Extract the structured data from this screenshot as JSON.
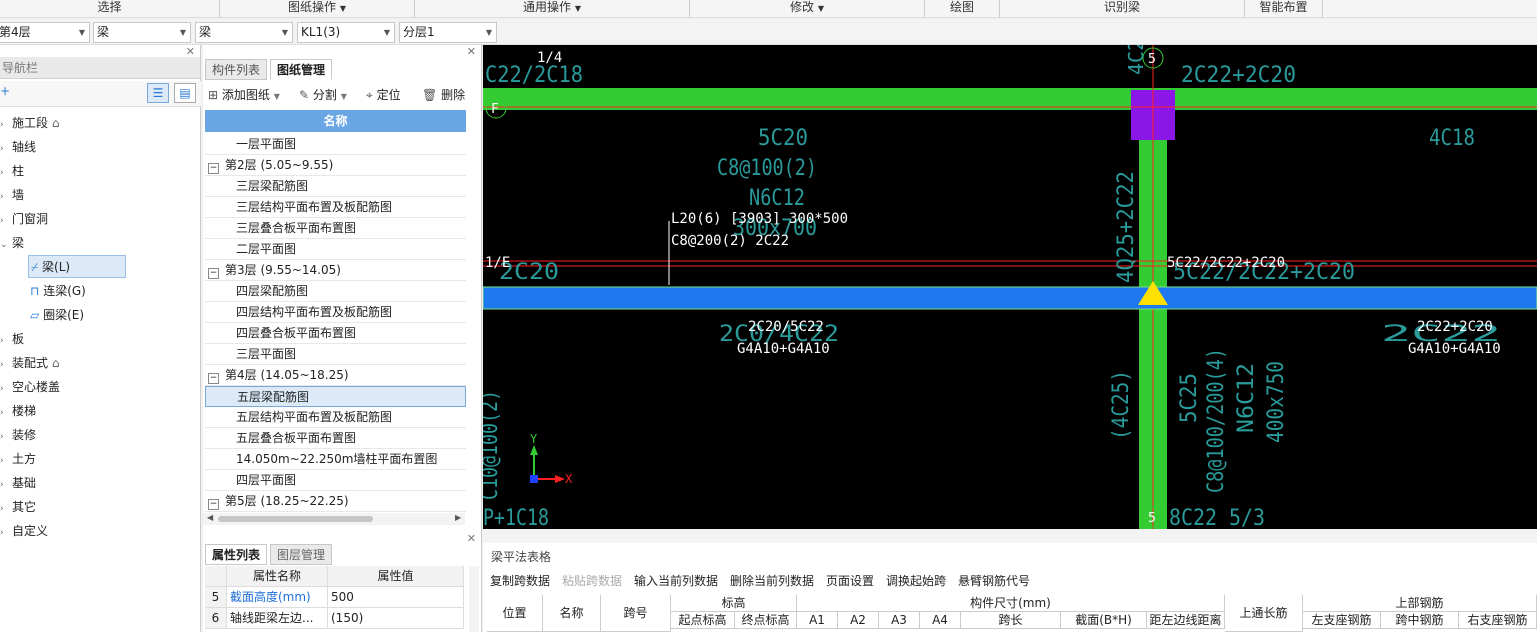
{
  "ribbon": {
    "groups": [
      "选择",
      "图纸操作",
      "通用操作",
      "修改",
      "绘图",
      "识别梁",
      "智能布置"
    ]
  },
  "selectors": {
    "floor": "第4层",
    "type": "梁",
    "subtype": "梁",
    "component": "KL1(3)",
    "layer": "分层1"
  },
  "nav": {
    "title": "导航栏",
    "items": [
      "施工段",
      "轴线",
      "柱",
      "墙",
      "门窗洞",
      "梁",
      "板",
      "装配式",
      "空心楼盖",
      "楼梯",
      "装修",
      "土方",
      "基础",
      "其它",
      "自定义"
    ],
    "beam_children": [
      "梁(L)",
      "连梁(G)",
      "圈梁(E)"
    ]
  },
  "mid": {
    "tabs": [
      "构件列表",
      "图纸管理"
    ],
    "toolbar": {
      "add": "添加图纸",
      "split": "分割",
      "locate": "定位",
      "delete": "删除"
    },
    "header": "名称",
    "rows": [
      {
        "text": "一层平面图",
        "kind": "child"
      },
      {
        "text": "第2层 (5.05~9.55)",
        "kind": "parent"
      },
      {
        "text": "三层梁配筋图",
        "kind": "child"
      },
      {
        "text": "三层结构平面布置及板配筋图",
        "kind": "child"
      },
      {
        "text": "三层叠合板平面布置图",
        "kind": "child"
      },
      {
        "text": "二层平面图",
        "kind": "child"
      },
      {
        "text": "第3层 (9.55~14.05)",
        "kind": "parent"
      },
      {
        "text": "四层梁配筋图",
        "kind": "child"
      },
      {
        "text": "四层结构平面布置及板配筋图",
        "kind": "child"
      },
      {
        "text": "四层叠合板平面布置图",
        "kind": "child"
      },
      {
        "text": "三层平面图",
        "kind": "child"
      },
      {
        "text": "第4层 (14.05~18.25)",
        "kind": "parent"
      },
      {
        "text": "五层梁配筋图",
        "kind": "child-selected"
      },
      {
        "text": "五层结构平面布置及板配筋图",
        "kind": "child"
      },
      {
        "text": "五层叠合板平面布置图",
        "kind": "child"
      },
      {
        "text": "14.050m~22.250m墙柱平面布置图",
        "kind": "child"
      },
      {
        "text": "四层平面图",
        "kind": "child"
      },
      {
        "text": "第5层 (18.25~22.25)",
        "kind": "parent"
      }
    ]
  },
  "props": {
    "tabs": [
      "属性列表",
      "图层管理"
    ],
    "headers": [
      "属性名称",
      "属性值"
    ],
    "rows": [
      {
        "n": "5",
        "name": "截面高度(mm)",
        "value": "500"
      },
      {
        "n": "6",
        "name": "轴线距梁左边...",
        "value": "(150)"
      }
    ]
  },
  "canvas": {
    "labels": {
      "t1": "1/4",
      "t2": "C22/2C18",
      "t3": "4C2",
      "t4": "2C22+2C20",
      "t5": "4C18",
      "t6": "5C20",
      "t7": "C8@100(2)",
      "t8": "N6C12",
      "t9": "300x700",
      "t10": "L20(6) [3903] 300*500",
      "t11": "C8@200(2) 2C22",
      "t12": "1/E",
      "t13": "2C20",
      "t14": "4Q25+2C22",
      "t15": "5C22/2C22+2C20",
      "t16": "5C22/2C22+2C20",
      "t17": "2C20/5C22",
      "t18": "G4A10+G4A10",
      "t19": "2C22+2C20",
      "t20": "G4A10+G4A10",
      "t21": "(4C25)",
      "t22": "5C25",
      "t23": "C8@100/200(4)",
      "t24": "N6C12",
      "t25": "400x750",
      "t26": "8C22 5/3",
      "t27": "P+1C18",
      "t28": "C10@100(2)",
      "t29": "2C0/4C22",
      "t30": "2C22"
    },
    "axes": {
      "f": "F",
      "n5": "5",
      "x": "X",
      "y": "Y"
    }
  },
  "bottom": {
    "title": "梁平法表格",
    "toolbar": [
      "复制跨数据",
      "粘贴跨数据",
      "输入当前列数据",
      "删除当前列数据",
      "页面设置",
      "调换起始跨",
      "悬臂钢筋代号"
    ],
    "headers1": [
      "位置",
      "名称",
      "跨号",
      "标高",
      "构件尺寸(mm)",
      "上通长筋",
      "上部钢筋"
    ],
    "headers2": [
      "起点标高",
      "终点标高",
      "A1",
      "A2",
      "A3",
      "A4",
      "跨长",
      "截面(B*H)",
      "距左边线距离",
      "左支座钢筋",
      "跨中钢筋",
      "右支座钢筋"
    ]
  },
  "colors": {
    "beam_green": "#33cc33",
    "beam_blue": "#1e78f0",
    "column": "#8a17e6",
    "cad_text": "#2a9a9a",
    "grid_red": "#ff2020"
  }
}
